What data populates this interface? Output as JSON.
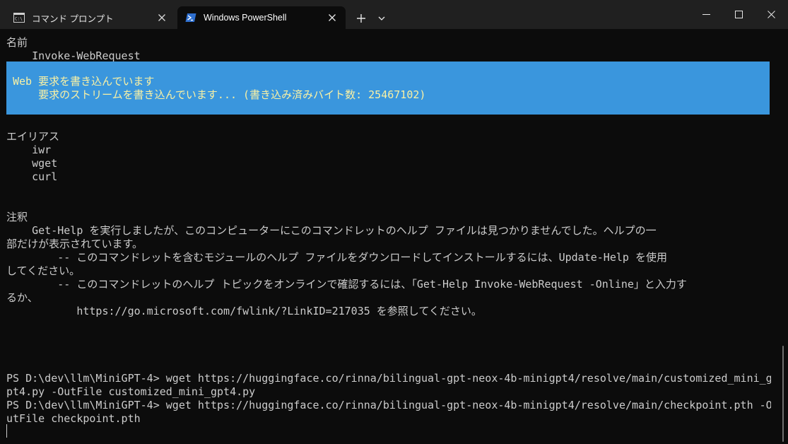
{
  "tabs": [
    {
      "label": "コマンド プロンプト",
      "icon": "cmd-icon",
      "active": false
    },
    {
      "label": "Windows PowerShell",
      "icon": "powershell-icon",
      "active": true
    }
  ],
  "titlebar_buttons": {
    "new_tab": "+",
    "dropdown": "chevron-down-icon"
  },
  "colors": {
    "background": "#0c0c0c",
    "text": "#cccccc",
    "progress_bg": "#3a96dd",
    "progress_text": "#f9f1a5",
    "tabbar": "#202020"
  },
  "progress": {
    "title": "Web 要求を書き込んでいます",
    "status": "    要求のストリームを書き込んでいます... (書き込み済みバイト数: 25467102)"
  },
  "lines": [
    "名前",
    "    Invoke-WebRequest",
    "",
    "",
    "",
    "",
    "",
    "エイリアス",
    "    iwr",
    "    wget",
    "    curl",
    "",
    "",
    "注釈",
    "    Get-Help を実行しましたが、このコンピューターにこのコマンドレットのヘルプ ファイルは見つかりませんでした。ヘルプの一",
    "部だけが表示されています。",
    "        -- このコマンドレットを含むモジュールのヘルプ ファイルをダウンロードしてインストールするには、Update-Help を使用",
    "してください。",
    "        -- このコマンドレットのヘルプ トピックをオンラインで確認するには、「Get-Help Invoke-WebRequest -Online」と入力す",
    "るか、",
    "           https://go.microsoft.com/fwlink/?LinkID=217035 を参照してください。",
    "",
    "",
    "",
    "",
    "PS D:\\dev\\llm\\MiniGPT-4> wget https://huggingface.co/rinna/bilingual-gpt-neox-4b-minigpt4/resolve/main/customized_mini_g",
    "pt4.py -OutFile customized_mini_gpt4.py",
    "PS D:\\dev\\llm\\MiniGPT-4> wget https://huggingface.co/rinna/bilingual-gpt-neox-4b-minigpt4/resolve/main/checkpoint.pth -O",
    "utFile checkpoint.pth",
    ""
  ]
}
